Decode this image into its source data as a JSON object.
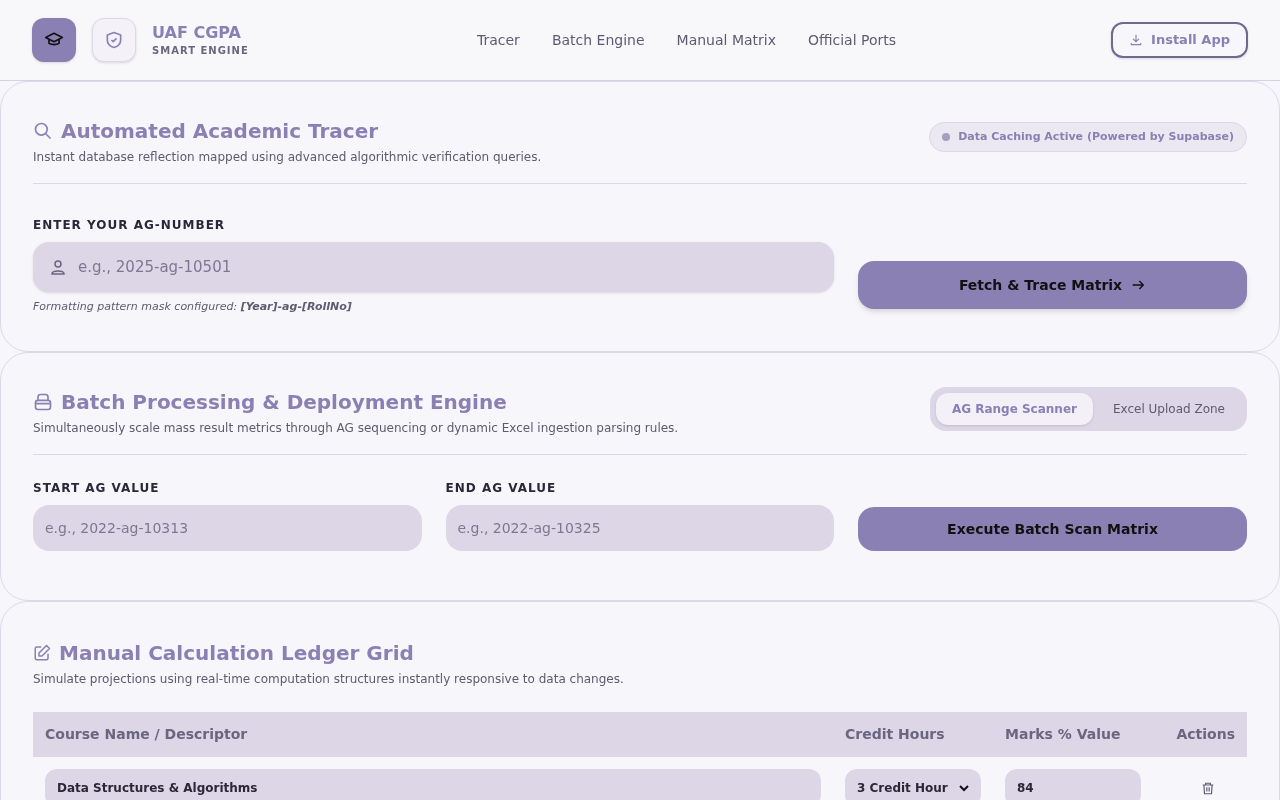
{
  "brand": {
    "title": "UAF CGPA",
    "subtitle": "SMART ENGINE"
  },
  "nav": [
    "Tracer",
    "Batch Engine",
    "Manual Matrix",
    "Official Ports"
  ],
  "install_button": "Install App",
  "tracer": {
    "title": "Automated Academic Tracer",
    "description": "Instant database reflection mapped using advanced algorithmic verification queries.",
    "status_badge": "Data Caching Active (Powered by Supabase)",
    "field_label": "ENTER YOUR AG-NUMBER",
    "placeholder": "e.g., 2025-ag-10501",
    "hint": "Formatting pattern mask configured: **[Year]-ag-[RollNo]**",
    "button": "Fetch & Trace Matrix"
  },
  "batch": {
    "title": "Batch Processing & Deployment Engine",
    "description": "Simultaneously scale mass result metrics through AG sequencing or dynamic Excel ingestion parsing rules.",
    "tabs": [
      {
        "label": "AG Range Scanner",
        "selected": true
      },
      {
        "label": "Excel Upload Zone",
        "selected": false
      }
    ],
    "fields": [
      {
        "label": "START AG VALUE",
        "placeholder": "e.g., 2022-ag-10313"
      },
      {
        "label": "END AG VALUE",
        "placeholder": "e.g., 2022-ag-10325"
      }
    ],
    "button": "Execute Batch Scan Matrix"
  },
  "manual": {
    "title": "Manual Calculation Ledger Grid",
    "description": "Simulate projections using real-time computation structures instantly responsive to data changes.",
    "table": {
      "columns": [
        "Course Name / Descriptor",
        "Credit Hours",
        "Marks % Value",
        "Actions"
      ],
      "rows": [
        {
          "course": "Data Structures & Algorithms",
          "credit_hours": "3 Credit Hour",
          "marks": "84"
        }
      ]
    }
  }
}
